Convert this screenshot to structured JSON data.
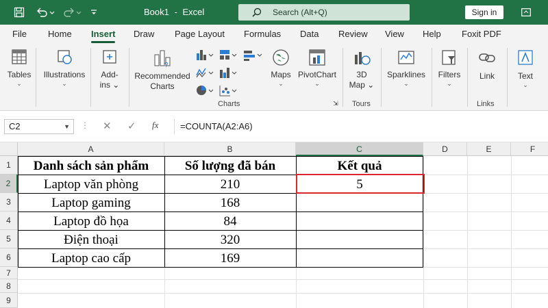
{
  "titlebar": {
    "filename": "Book1",
    "separator": "-",
    "app": "Excel",
    "search_placeholder": "Search (Alt+Q)",
    "signin_label": "Sign in"
  },
  "tabs": [
    "File",
    "Home",
    "Insert",
    "Draw",
    "Page Layout",
    "Formulas",
    "Data",
    "Review",
    "View",
    "Help",
    "Foxit PDF"
  ],
  "active_tab": "Insert",
  "ribbon": {
    "tables": "Tables",
    "illustrations": "Illustrations",
    "addins_1": "Add-",
    "addins_2": "ins",
    "recommended_1": "Recommended",
    "recommended_2": "Charts",
    "maps": "Maps",
    "pivotchart": "PivotChart",
    "map3d_1": "3D",
    "map3d_2": "Map",
    "sparklines": "Sparklines",
    "filters": "Filters",
    "link": "Link",
    "text": "Text",
    "group_charts": "Charts",
    "group_tours": "Tours",
    "group_links": "Links"
  },
  "formula_bar": {
    "name_box": "C2",
    "formula": "=COUNTA(A2:A6)"
  },
  "columns": [
    "A",
    "B",
    "C",
    "D",
    "E",
    "F"
  ],
  "rows": [
    "1",
    "2",
    "3",
    "4",
    "5",
    "6",
    "7",
    "8",
    "9"
  ],
  "table": {
    "header": [
      "Danh sách sản phẩm",
      "Số lượng đã bán",
      "Kết quả"
    ],
    "rows": [
      [
        "Laptop văn phòng",
        "210",
        "5"
      ],
      [
        "Laptop gaming",
        "168",
        ""
      ],
      [
        "Laptop đồ họa",
        "84",
        ""
      ],
      [
        "Điện thoại",
        "320",
        ""
      ],
      [
        "Laptop cao cấp",
        "169",
        ""
      ]
    ]
  },
  "colors": {
    "excel_green": "#217346",
    "selection_red": "#d9262e"
  }
}
